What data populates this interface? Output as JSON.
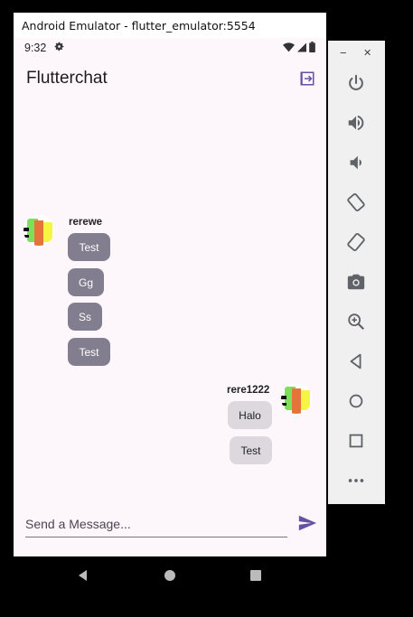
{
  "window": {
    "title": "Android Emulator - flutter_emulator:5554"
  },
  "status_bar": {
    "time": "9:32"
  },
  "app_bar": {
    "title": "Flutterchat"
  },
  "chat": {
    "other": {
      "username": "rerewe",
      "messages": [
        "Test",
        "Gg",
        "Ss",
        "Test"
      ]
    },
    "me": {
      "username": "rere1222",
      "messages": [
        "Halo",
        "Test"
      ]
    }
  },
  "composer": {
    "placeholder": "Send a Message..."
  },
  "side_panel": {
    "minimize": "−",
    "close": "✕",
    "tools": [
      "power-icon",
      "volume-up-icon",
      "volume-down-icon",
      "rotate-left-icon",
      "rotate-right-icon",
      "camera-icon",
      "zoom-icon",
      "back-icon",
      "home-icon",
      "overview-icon",
      "more-icon"
    ]
  },
  "colors": {
    "accent": "#6750a4",
    "bubble_other": "#837e8f",
    "bubble_me": "#dcd8dd",
    "background": "#fdf7fc"
  }
}
